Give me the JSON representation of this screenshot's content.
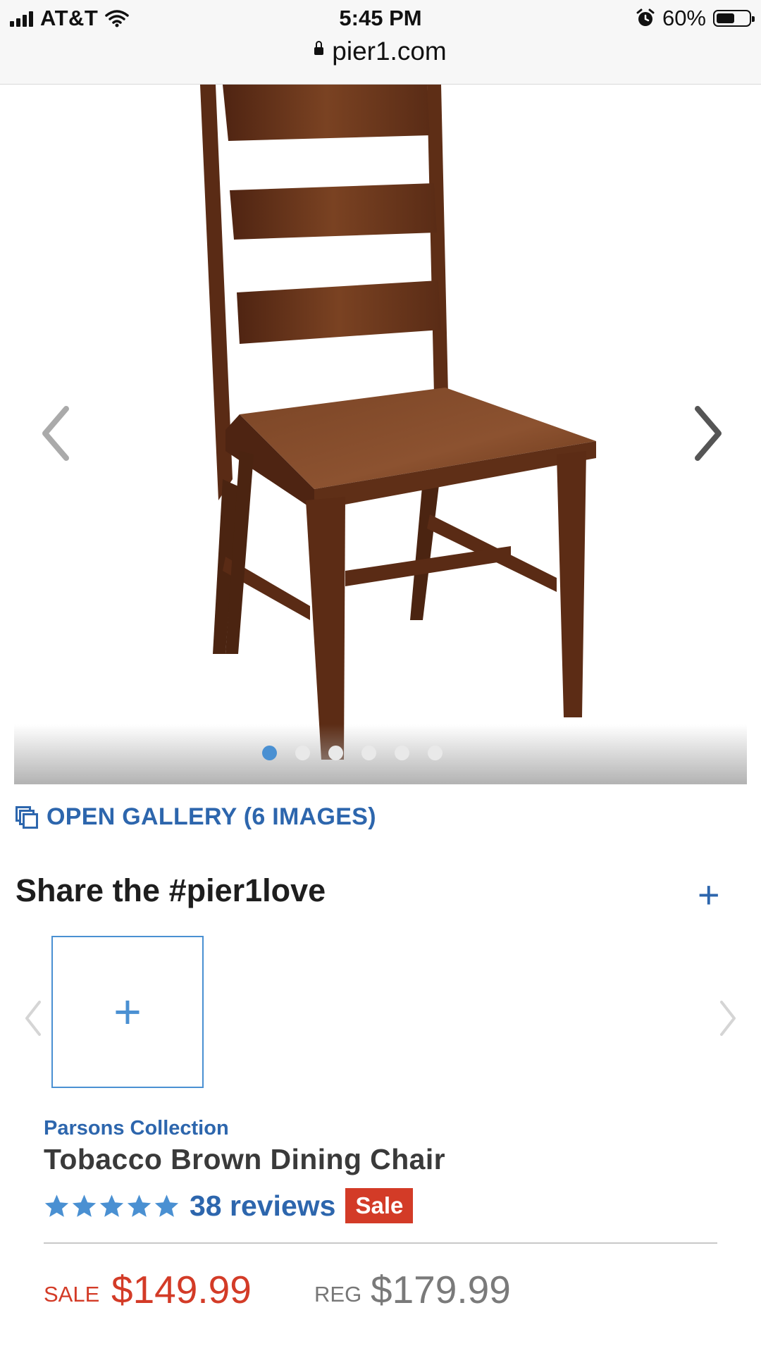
{
  "status_bar": {
    "carrier": "AT&T",
    "time": "5:45 PM",
    "battery": "60%",
    "battery_level": 0.6,
    "icons": [
      "signal-icon",
      "wifi-icon",
      "alarm-icon",
      "battery-icon"
    ]
  },
  "browser": {
    "url": "pier1.com"
  },
  "carousel": {
    "image_alt": "Tobacco Brown Dining Chair",
    "image_count": 6,
    "active_index": 0
  },
  "gallery": {
    "label": "OPEN GALLERY (6 IMAGES)"
  },
  "share": {
    "title": "Share the #pier1love",
    "expand_symbol": "+",
    "add_symbol": "+"
  },
  "product": {
    "collection": "Parsons Collection",
    "name": "Tobacco Brown Dining Chair",
    "rating_stars": 5,
    "reviews": "38 reviews",
    "badge": "Sale",
    "sale_label": "SALE",
    "sale_price": "$149.99",
    "reg_label": "REG",
    "reg_price": "$179.99"
  },
  "colors": {
    "link_blue": "#2d66ad",
    "accent_blue": "#4a90d2",
    "sale_red": "#d33b27",
    "wood": "#6e3a1c"
  }
}
